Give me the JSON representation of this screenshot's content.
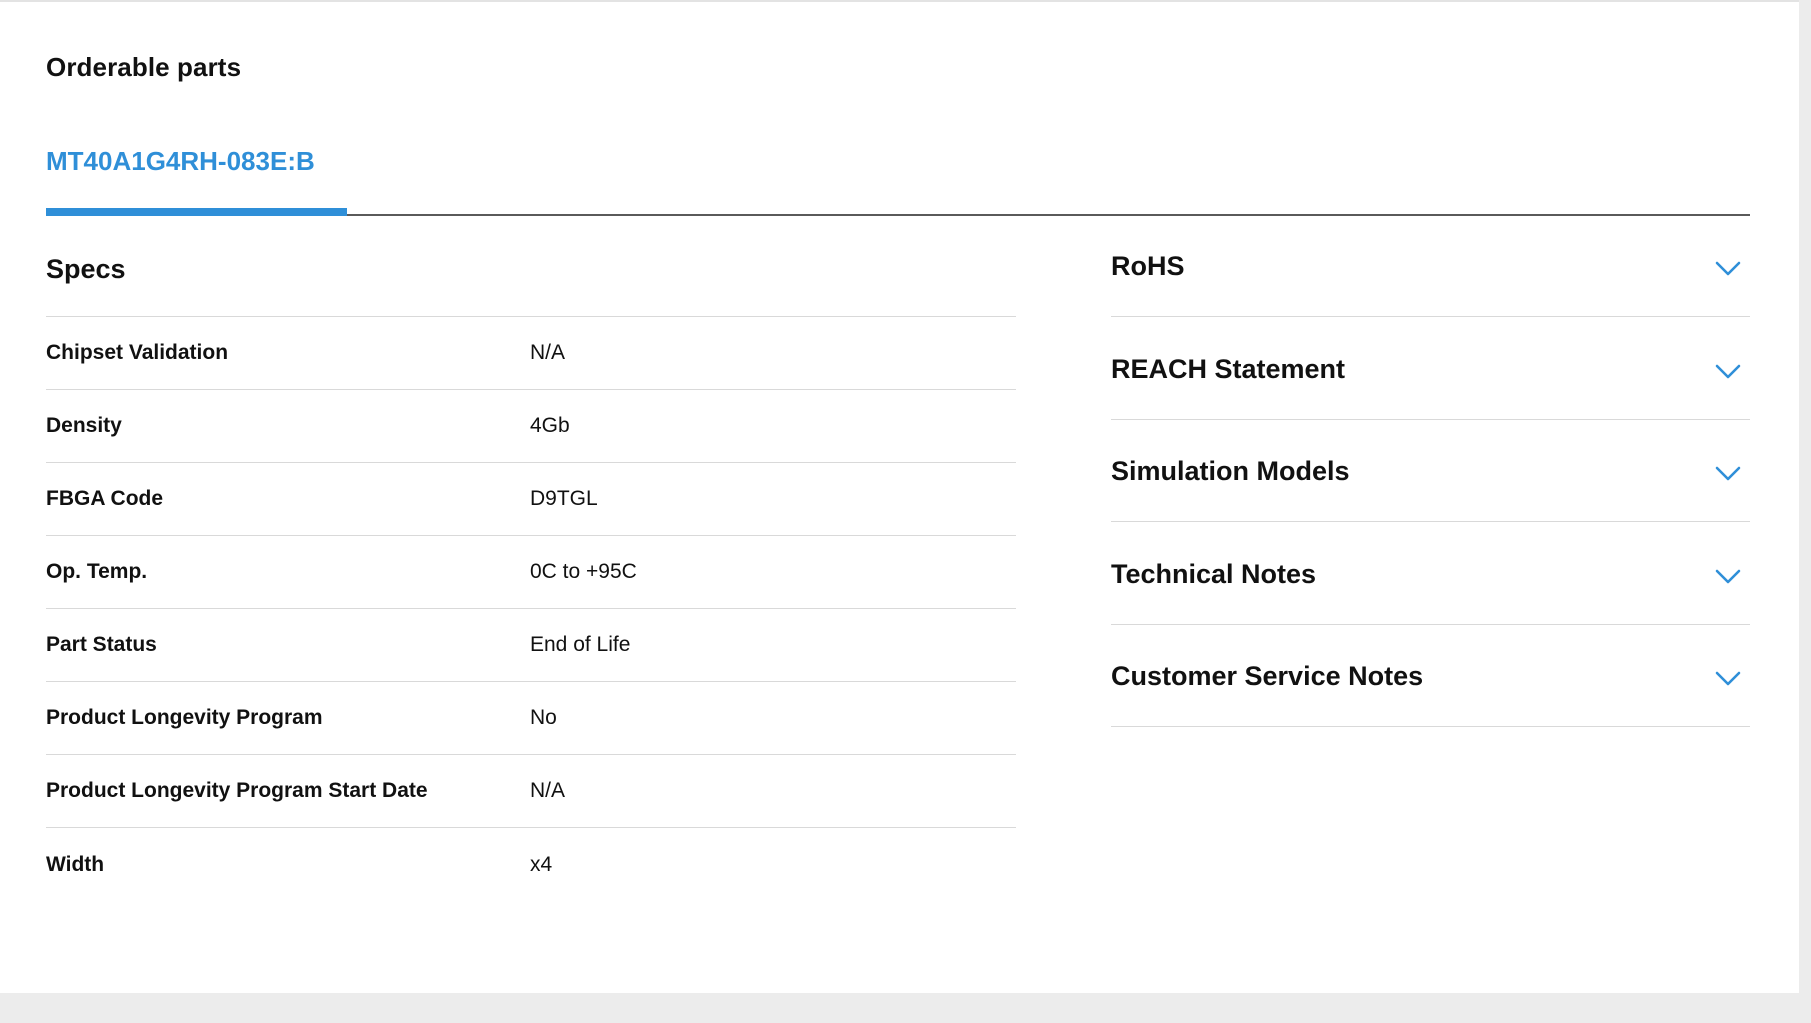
{
  "header": {
    "title": "Orderable parts"
  },
  "tabs": [
    {
      "label": "MT40A1G4RH-083E:B",
      "active": true
    }
  ],
  "specs": {
    "title": "Specs",
    "rows": [
      {
        "label": "Chipset Validation",
        "value": "N/A"
      },
      {
        "label": "Density",
        "value": "4Gb"
      },
      {
        "label": "FBGA Code",
        "value": "D9TGL"
      },
      {
        "label": "Op. Temp.",
        "value": "0C to +95C"
      },
      {
        "label": "Part Status",
        "value": "End of Life"
      },
      {
        "label": "Product Longevity Program",
        "value": "No"
      },
      {
        "label": "Product Longevity Program Start Date",
        "value": "N/A"
      },
      {
        "label": "Width",
        "value": "x4"
      }
    ]
  },
  "accordion": {
    "items": [
      {
        "label": "RoHS",
        "icon": "chevron-down-icon"
      },
      {
        "label": "REACH Statement",
        "icon": "chevron-down-icon"
      },
      {
        "label": "Simulation Models",
        "icon": "chevron-down-icon"
      },
      {
        "label": "Technical Notes",
        "icon": "chevron-down-icon"
      },
      {
        "label": "Customer Service Notes",
        "icon": "chevron-down-icon"
      }
    ]
  },
  "colors": {
    "accent": "#2f8fd8",
    "text": "#111111",
    "divider": "#d9d9d9",
    "tab_baseline": "#5a5a5a",
    "page_background": "#ececec",
    "card_background": "#ffffff"
  }
}
